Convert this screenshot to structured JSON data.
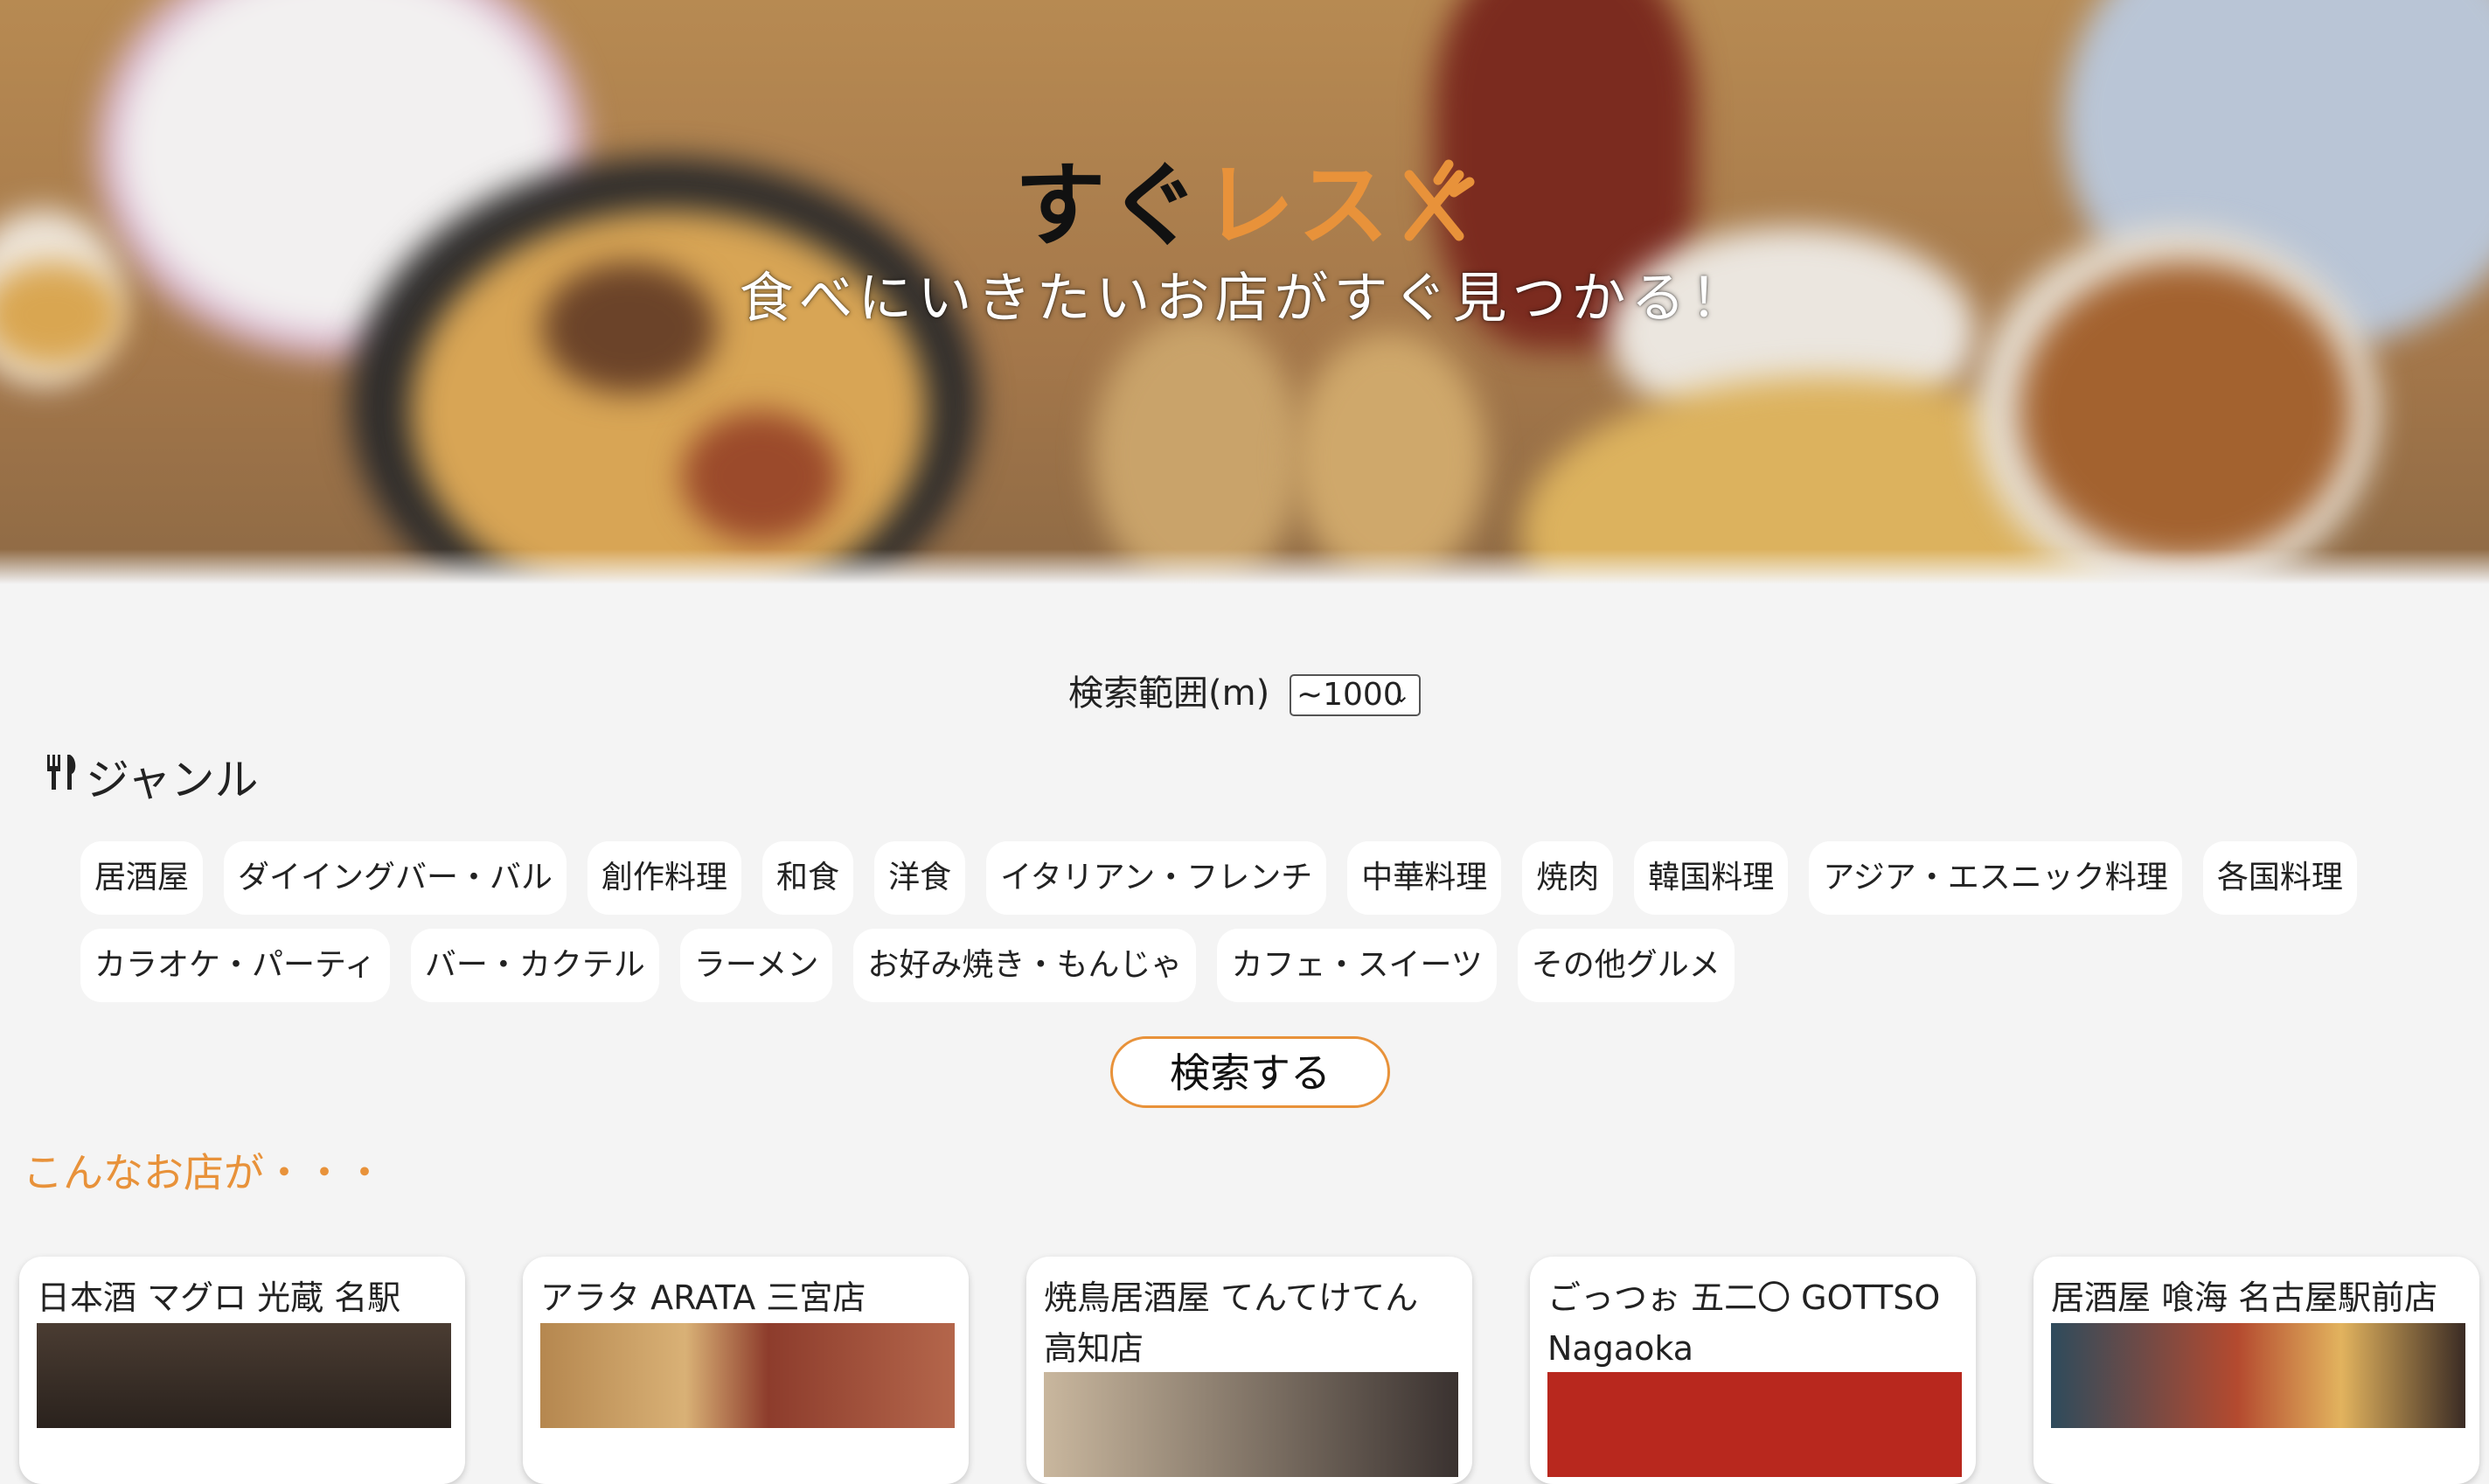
{
  "hero": {
    "logo_black": "すぐ",
    "logo_orange": "レス",
    "logo_icon": "fork-knife-icon",
    "tagline": "食べにいきたいお店がすぐ見つかる！"
  },
  "search": {
    "range_label": "検索範囲(m)",
    "range_value": "~1000",
    "button_label": "検索する"
  },
  "genre": {
    "title": "ジャンル",
    "icon": "cutlery-icon",
    "items": [
      "居酒屋",
      "ダイイングバー・バル",
      "創作料理",
      "和食",
      "洋食",
      "イタリアン・フレンチ",
      "中華料理",
      "焼肉",
      "韓国料理",
      "アジア・エスニック料理",
      "各国料理",
      "カラオケ・パーティ",
      "バー・カクテル",
      "ラーメン",
      "お好み焼き・もんじゃ",
      "カフェ・スイーツ",
      "その他グルメ"
    ]
  },
  "results": {
    "title": "こんなお店が・・・",
    "cards": [
      {
        "name": "日本酒 マグロ 光蔵 名駅"
      },
      {
        "name": "アラタ ARATA 三宮店"
      },
      {
        "name": "焼鳥居酒屋 てんてけてん 高知店"
      },
      {
        "name": "ごっつぉ 五二〇 GOTTSO Nagaoka"
      },
      {
        "name": "居酒屋 喰海 名古屋駅前店"
      }
    ]
  },
  "colors": {
    "accent": "#e8923a",
    "background": "#f4f4f4"
  }
}
